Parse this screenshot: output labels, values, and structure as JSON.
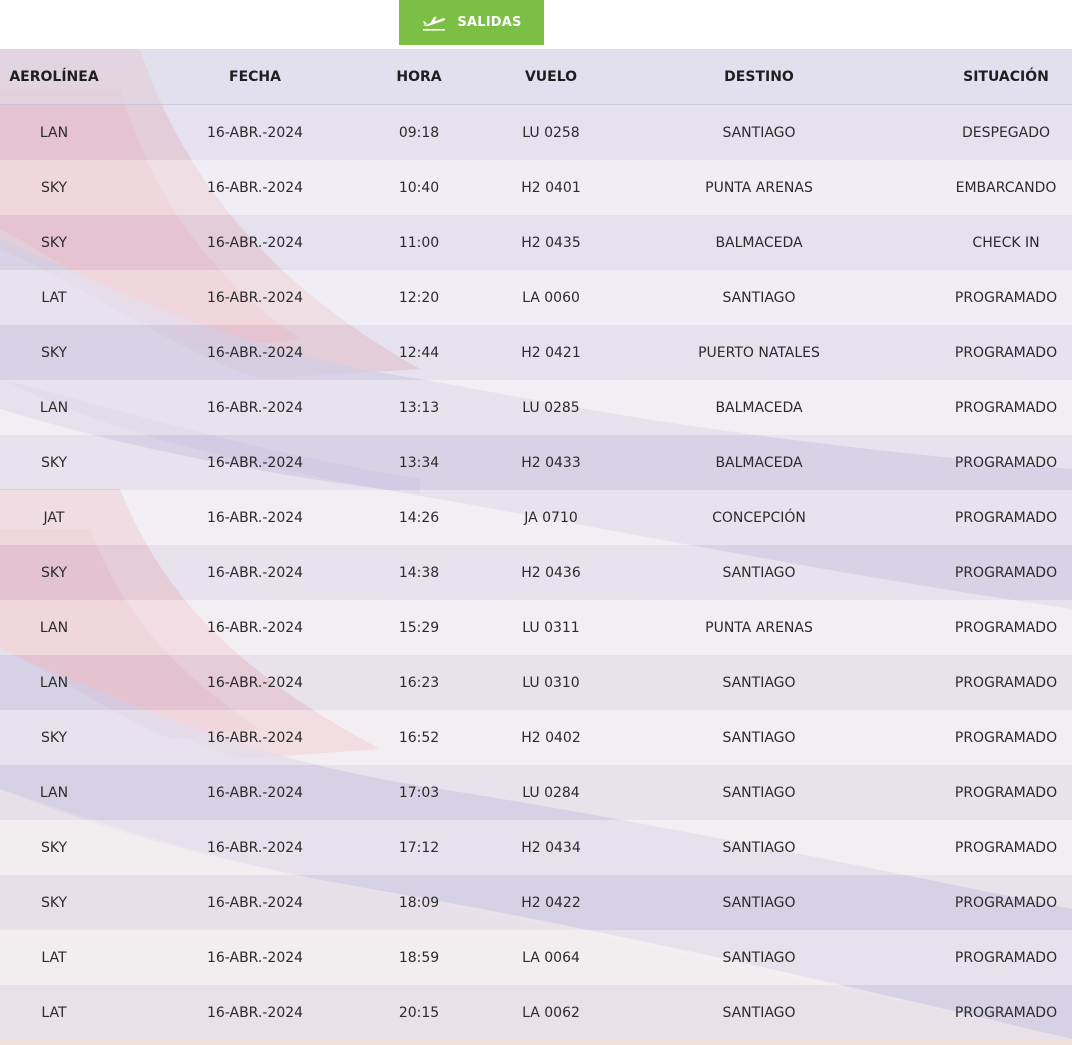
{
  "tab": {
    "label": "SALIDAS",
    "icon": "plane-departure-icon",
    "color": "#7cbf45"
  },
  "table": {
    "headers": {
      "airline": "AEROLÍNEA",
      "date": "FECHA",
      "time": "HORA",
      "flight": "VUELO",
      "destination": "DESTINO",
      "status": "SITUACIÓN"
    },
    "rows": [
      {
        "airline": "LAN",
        "date": "16-ABR.-2024",
        "time": "09:18",
        "flight": "LU 0258",
        "destination": "SANTIAGO",
        "status": "DESPEGADO"
      },
      {
        "airline": "SKY",
        "date": "16-ABR.-2024",
        "time": "10:40",
        "flight": "H2 0401",
        "destination": "PUNTA ARENAS",
        "status": "EMBARCANDO"
      },
      {
        "airline": "SKY",
        "date": "16-ABR.-2024",
        "time": "11:00",
        "flight": "H2 0435",
        "destination": "BALMACEDA",
        "status": "CHECK IN"
      },
      {
        "airline": "LAT",
        "date": "16-ABR.-2024",
        "time": "12:20",
        "flight": "LA 0060",
        "destination": "SANTIAGO",
        "status": "PROGRAMADO"
      },
      {
        "airline": "SKY",
        "date": "16-ABR.-2024",
        "time": "12:44",
        "flight": "H2 0421",
        "destination": "PUERTO NATALES",
        "status": "PROGRAMADO"
      },
      {
        "airline": "LAN",
        "date": "16-ABR.-2024",
        "time": "13:13",
        "flight": "LU 0285",
        "destination": "BALMACEDA",
        "status": "PROGRAMADO"
      },
      {
        "airline": "SKY",
        "date": "16-ABR.-2024",
        "time": "13:34",
        "flight": "H2 0433",
        "destination": "BALMACEDA",
        "status": "PROGRAMADO"
      },
      {
        "airline": "JAT",
        "date": "16-ABR.-2024",
        "time": "14:26",
        "flight": "JA 0710",
        "destination": "CONCEPCIÓN",
        "status": "PROGRAMADO"
      },
      {
        "airline": "SKY",
        "date": "16-ABR.-2024",
        "time": "14:38",
        "flight": "H2 0436",
        "destination": "SANTIAGO",
        "status": "PROGRAMADO"
      },
      {
        "airline": "LAN",
        "date": "16-ABR.-2024",
        "time": "15:29",
        "flight": "LU 0311",
        "destination": "PUNTA ARENAS",
        "status": "PROGRAMADO"
      },
      {
        "airline": "LAN",
        "date": "16-ABR.-2024",
        "time": "16:23",
        "flight": "LU 0310",
        "destination": "SANTIAGO",
        "status": "PROGRAMADO"
      },
      {
        "airline": "SKY",
        "date": "16-ABR.-2024",
        "time": "16:52",
        "flight": "H2 0402",
        "destination": "SANTIAGO",
        "status": "PROGRAMADO"
      },
      {
        "airline": "LAN",
        "date": "16-ABR.-2024",
        "time": "17:03",
        "flight": "LU 0284",
        "destination": "SANTIAGO",
        "status": "PROGRAMADO"
      },
      {
        "airline": "SKY",
        "date": "16-ABR.-2024",
        "time": "17:12",
        "flight": "H2 0434",
        "destination": "SANTIAGO",
        "status": "PROGRAMADO"
      },
      {
        "airline": "SKY",
        "date": "16-ABR.-2024",
        "time": "18:09",
        "flight": "H2 0422",
        "destination": "SANTIAGO",
        "status": "PROGRAMADO"
      },
      {
        "airline": "LAT",
        "date": "16-ABR.-2024",
        "time": "18:59",
        "flight": "LA 0064",
        "destination": "SANTIAGO",
        "status": "PROGRAMADO"
      },
      {
        "airline": "LAT",
        "date": "16-ABR.-2024",
        "time": "20:15",
        "flight": "LA 0062",
        "destination": "SANTIAGO",
        "status": "PROGRAMADO"
      }
    ]
  }
}
